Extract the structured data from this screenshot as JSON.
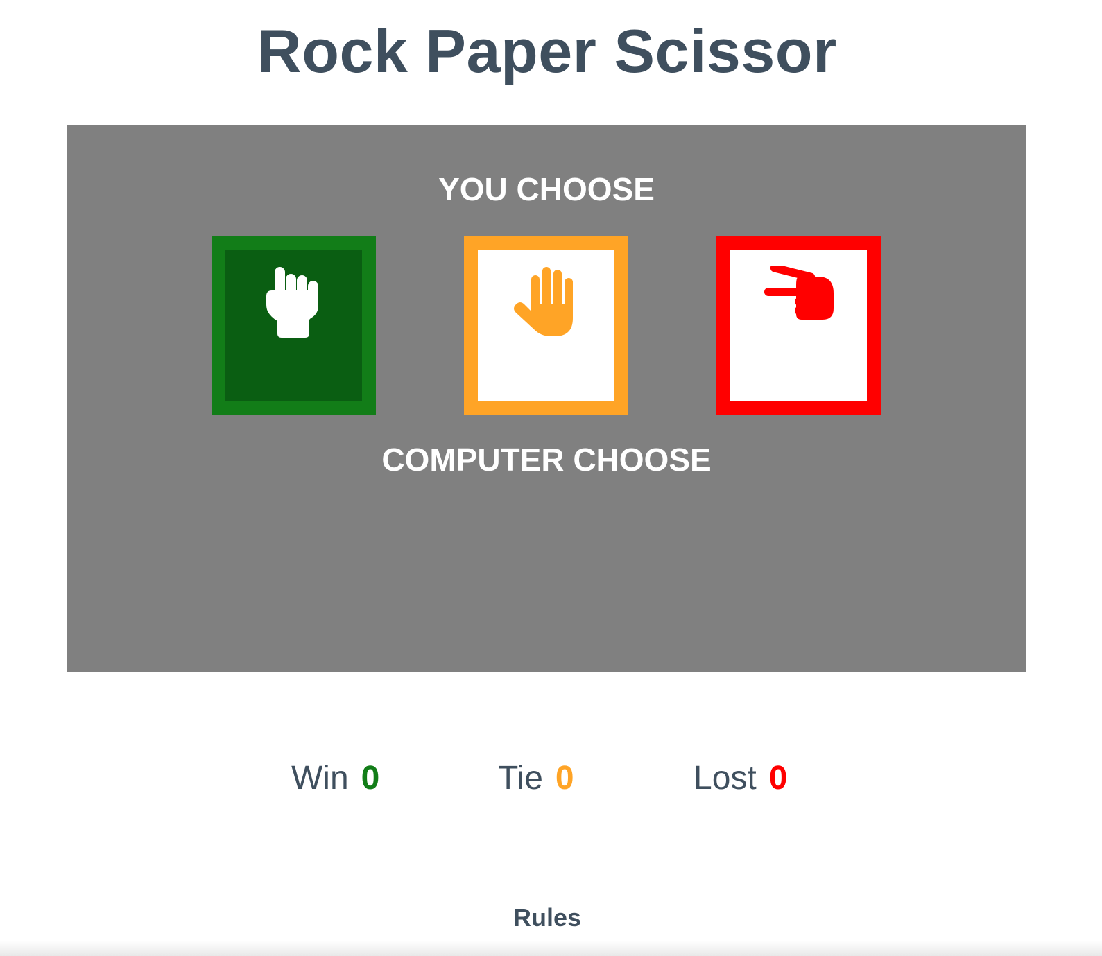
{
  "title": "Rock Paper Scissor",
  "board": {
    "you_choose": "YOU CHOOSE",
    "computer_choose": "COMPUTER CHOOSE",
    "choices": [
      {
        "id": "rock",
        "icon": "fist-icon",
        "color": "#127d18",
        "fill": "#0a5e12",
        "selected": true
      },
      {
        "id": "paper",
        "icon": "open-hand-icon",
        "color": "#ffa426",
        "fill": "#ffffff",
        "selected": false
      },
      {
        "id": "scissor",
        "icon": "scissors-hand-icon",
        "color": "#ff0000",
        "fill": "#ffffff",
        "selected": false
      }
    ]
  },
  "score": {
    "win_label": "Win",
    "win_value": "0",
    "tie_label": "Tie",
    "tie_value": "0",
    "lost_label": "Lost",
    "lost_value": "0"
  },
  "rules_label": "Rules",
  "colors": {
    "title": "#3f4f5e",
    "board": "#808080",
    "win": "#127d18",
    "tie": "#ffa426",
    "lost": "#ff0000"
  }
}
